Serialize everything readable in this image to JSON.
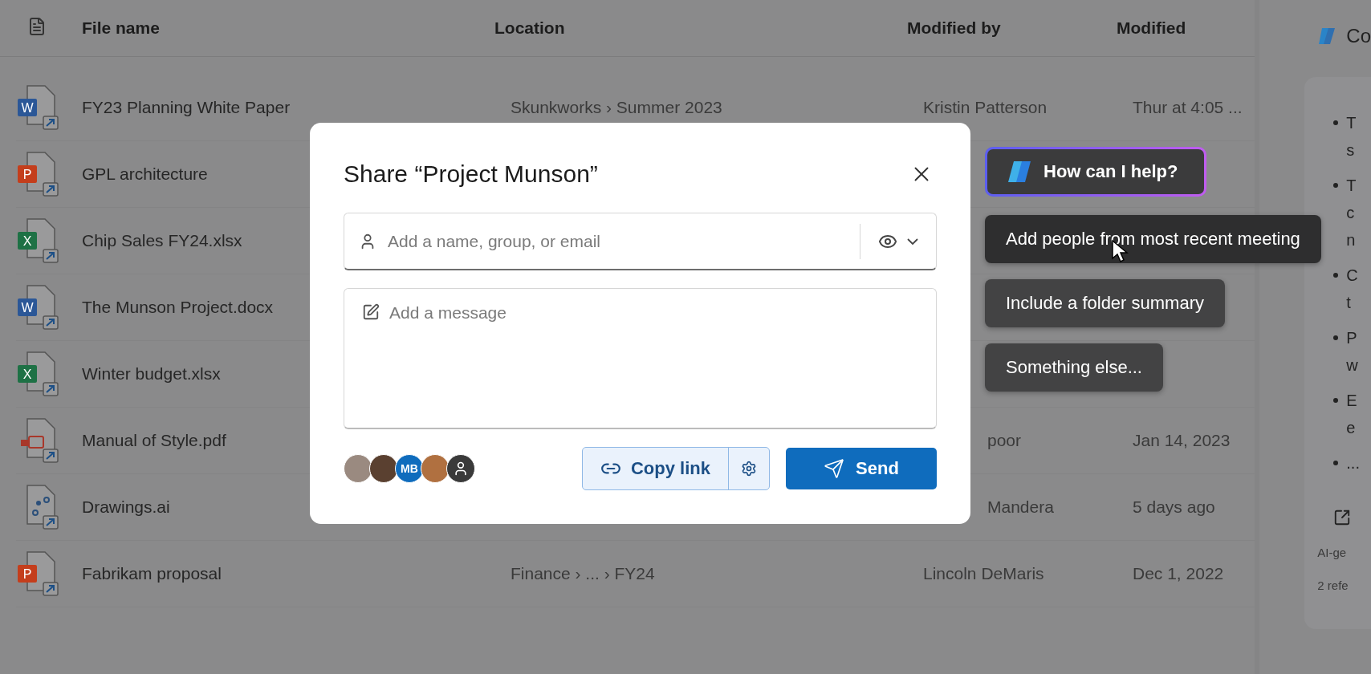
{
  "table": {
    "columns": [
      "File name",
      "Location",
      "Modified by",
      "Modified"
    ],
    "rows": [
      {
        "kind": "word",
        "badge": "W",
        "name": "FY23 Planning White Paper",
        "location": "Skunkworks › Summer 2023",
        "modified_by": "Kristin Patterson",
        "modified": "Thur at 4:05 ..."
      },
      {
        "kind": "powerpoint",
        "badge": "P",
        "name": "GPL architecture"
      },
      {
        "kind": "excel",
        "badge": "X",
        "name": "Chip Sales FY24.xlsx"
      },
      {
        "kind": "word",
        "badge": "W",
        "name": "The Munson Project.docx"
      },
      {
        "kind": "excel",
        "badge": "X",
        "name": "Winter budget.xlsx"
      },
      {
        "kind": "pdf",
        "name": "Manual of Style.pdf",
        "modified_by": "poor",
        "modified": "Jan 14, 2023"
      },
      {
        "kind": "drawing",
        "name": "Drawings.ai",
        "modified_by": "Mandera",
        "modified": "5 days ago"
      },
      {
        "kind": "powerpoint",
        "badge": "P",
        "name": "Fabrikam proposal",
        "location": "Finance › ... › FY24",
        "modified_by": "Lincoln DeMaris",
        "modified": "Dec 1, 2022"
      }
    ]
  },
  "copilot_panel": {
    "title": "Co",
    "bullets": [
      [
        "T",
        "s"
      ],
      [
        "T",
        "c",
        "n"
      ],
      [
        "C",
        "t"
      ],
      [
        "P",
        "w"
      ],
      [
        "E",
        "e"
      ],
      [
        "..."
      ]
    ],
    "footer": [
      "AI-ge",
      "2 refe"
    ]
  },
  "share_dialog": {
    "title": "Share “Project Munson”",
    "recipient": {
      "placeholder": "Add a name, group, or email"
    },
    "message": {
      "placeholder": "Add a message"
    },
    "avatars": [
      {
        "kind": "photo"
      },
      {
        "kind": "photo"
      },
      {
        "kind": "initials",
        "initials": "MB"
      },
      {
        "kind": "photo"
      },
      {
        "kind": "generic"
      }
    ],
    "copy_link": "Copy link",
    "send": "Send"
  },
  "copilot_prompt": {
    "title": "How can I help?",
    "suggestions": [
      {
        "label": "Add people from most recent meeting",
        "hovered": true
      },
      {
        "label": "Include a folder summary",
        "hovered": false
      },
      {
        "label": "Something else...",
        "hovered": false
      }
    ]
  }
}
